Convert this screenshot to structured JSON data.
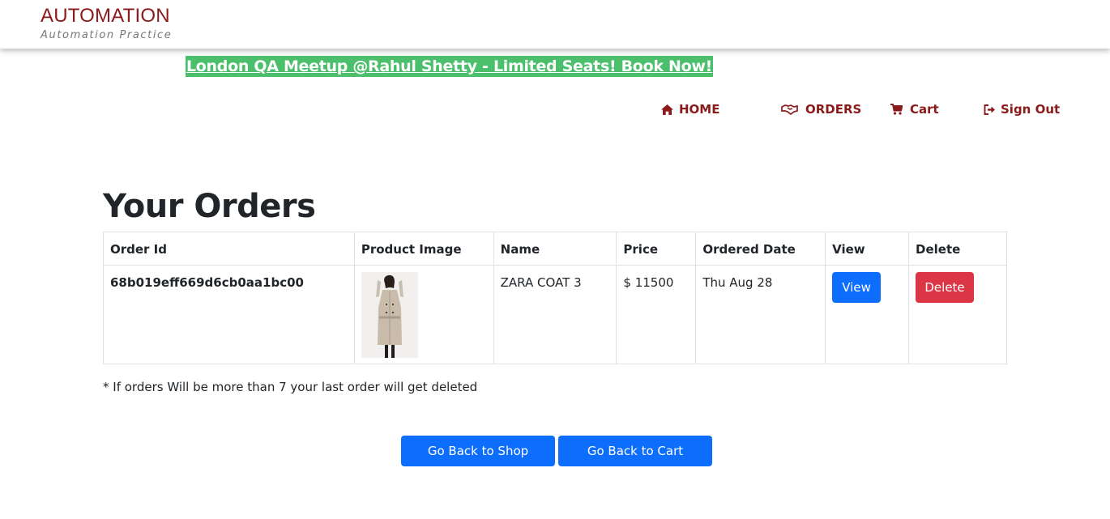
{
  "brand": {
    "title": "AUTOMATION",
    "subtitle": "Automation Practice"
  },
  "promo": {
    "text": "London QA Meetup @Rahul Shetty - Limited Seats! Book Now!"
  },
  "nav": {
    "home": {
      "label": "HOME",
      "icon": "home-icon"
    },
    "orders": {
      "label": "ORDERS",
      "icon": "handshake-icon"
    },
    "cart": {
      "label": "Cart",
      "icon": "cart-icon"
    },
    "signout": {
      "label": "Sign Out",
      "icon": "sign-out-icon"
    }
  },
  "page": {
    "title": "Your Orders"
  },
  "table": {
    "headers": [
      "Order Id",
      "Product Image",
      "Name",
      "Price",
      "Ordered Date",
      "View",
      "Delete"
    ],
    "rows": [
      {
        "order_id": "68b019eff669d6cb0aa1bc00",
        "name": "ZARA COAT 3",
        "price": "$ 11500",
        "date": "Thu Aug 28",
        "view_label": "View",
        "delete_label": "Delete"
      }
    ]
  },
  "note": "* If orders Will be more than 7 your last order will get deleted",
  "buttons": {
    "back_shop": "Go Back to Shop",
    "back_cart": "Go Back to Cart"
  },
  "colors": {
    "brand": "#8b1a1a",
    "promo_bg": "#4bbf6b",
    "primary": "#0d6efd",
    "danger": "#dc3545"
  }
}
